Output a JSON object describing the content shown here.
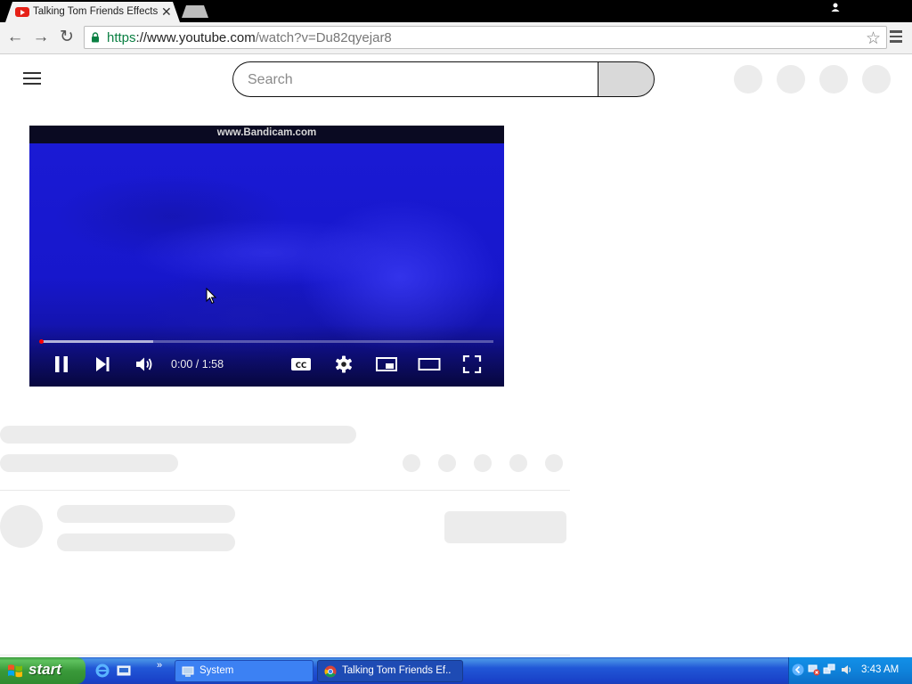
{
  "browser": {
    "active_tab_title": "Talking Tom Friends Effects",
    "url_scheme": "https",
    "url_rest_host": "://www.youtube.com",
    "url_path": "/watch?v=Du82qyejar8"
  },
  "youtube": {
    "search_placeholder": "Search"
  },
  "player": {
    "watermark": "www.Bandicam.com",
    "time": "0:00 / 1:58",
    "played_fraction": 0.0,
    "buffered_fraction": 0.25,
    "video_color": "#1a1ad4"
  },
  "taskbar": {
    "start_label": "start",
    "tasks": [
      {
        "label": "System",
        "icon": "system-icon",
        "active": false
      },
      {
        "label": "Talking Tom Friends Ef...",
        "icon": "chrome-icon",
        "active": true
      }
    ],
    "clock": "3:43 AM"
  },
  "colors": {
    "skeleton": "#ececec",
    "progress_played": "#ff0000",
    "xp_taskbar": "#2157d7",
    "xp_start": "#3a9a3a"
  }
}
